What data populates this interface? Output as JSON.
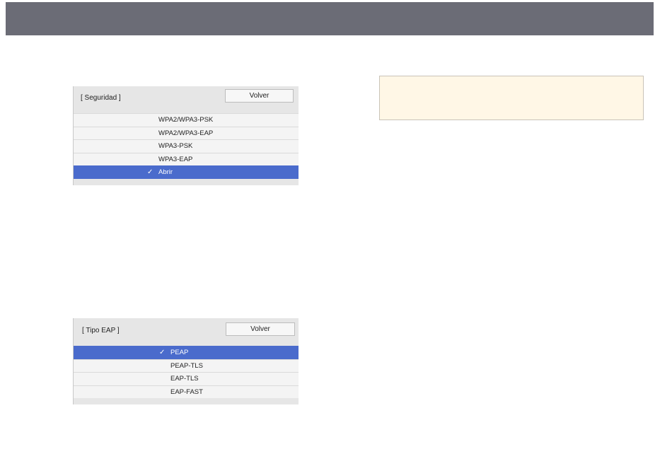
{
  "security_dialog": {
    "title": "[ Seguridad ]",
    "back_label": "Volver",
    "options": [
      {
        "label": "WPA2/WPA3-PSK",
        "selected": false
      },
      {
        "label": "WPA2/WPA3-EAP",
        "selected": false
      },
      {
        "label": "WPA3-PSK",
        "selected": false
      },
      {
        "label": "WPA3-EAP",
        "selected": false
      },
      {
        "label": "Abrir",
        "selected": true
      }
    ]
  },
  "eap_dialog": {
    "title": "[ Tipo EAP ]",
    "back_label": "Volver",
    "options": [
      {
        "label": "PEAP",
        "selected": true
      },
      {
        "label": "PEAP-TLS",
        "selected": false
      },
      {
        "label": "EAP-TLS",
        "selected": false
      },
      {
        "label": "EAP-FAST",
        "selected": false
      }
    ]
  },
  "check_glyph": "✓",
  "icons": {
    "check": "check-icon"
  },
  "colors": {
    "header_bar": "#6b6c76",
    "selected_row": "#4a6bcc",
    "note_background": "#fff7e6"
  }
}
